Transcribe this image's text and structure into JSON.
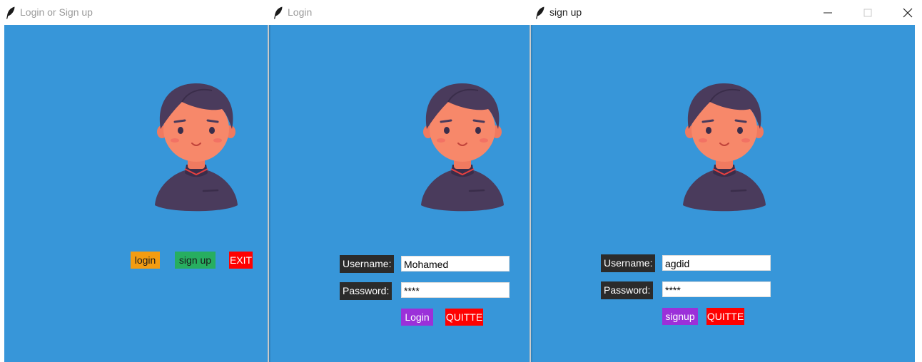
{
  "windows": {
    "main": {
      "title": "Login or Sign up",
      "buttons": {
        "login": "login",
        "signup": "sign up",
        "exit": "EXIT"
      }
    },
    "login": {
      "title": "Login",
      "username_label": "Username:",
      "password_label": "Password:",
      "username_value": "Mohamed",
      "password_value": "****",
      "submit_label": "Login",
      "quit_label": "QUITTE"
    },
    "signup": {
      "title": "sign up",
      "username_label": "Username:",
      "password_label": "Password:",
      "username_value": "agdid",
      "password_value": "****",
      "submit_label": "signup",
      "quit_label": "QUITTE"
    }
  },
  "window_controls": [
    "minimize-icon",
    "maximize-icon",
    "close-icon"
  ],
  "icons": {
    "window_icon": "feather-icon",
    "avatar": "user-avatar-illustration"
  },
  "colors": {
    "background": "#3796d9",
    "login_button": "#f39c12",
    "signup_button": "#27ae60",
    "exit_button": "#ff0000",
    "submit_button": "#9b30d9",
    "quit_button": "#ff0000",
    "label_bg": "#2b2b2b"
  }
}
